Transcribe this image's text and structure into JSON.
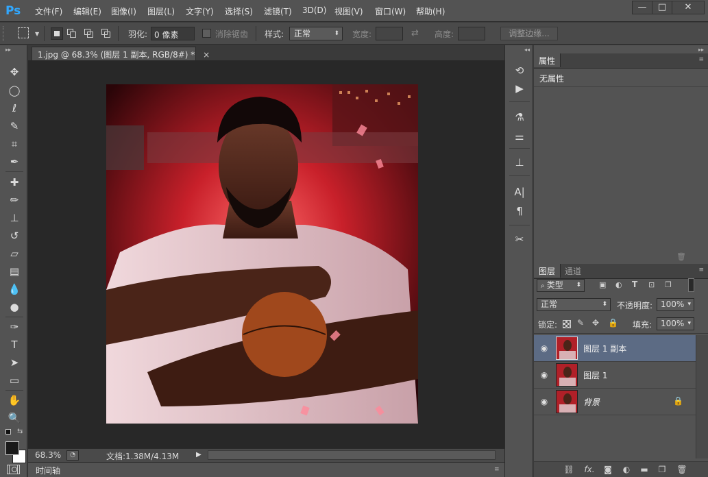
{
  "app": {
    "logo": "Ps"
  },
  "menu": [
    "文件(F)",
    "编辑(E)",
    "图像(I)",
    "图层(L)",
    "文字(Y)",
    "选择(S)",
    "滤镜(T)",
    "3D(D)",
    "视图(V)",
    "窗口(W)",
    "帮助(H)"
  ],
  "window_controls": {
    "minimize": "—",
    "maximize": "□",
    "close": "✕"
  },
  "options": {
    "feather_label": "羽化:",
    "feather_value": "0 像素",
    "antialias_label": "消除锯齿",
    "style_label": "样式:",
    "style_value": "正常",
    "width_label": "宽度:",
    "height_label": "高度:",
    "refine_edge": "调整边缘..."
  },
  "document": {
    "tab_title": "1.jpg @ 68.3% (图层 1 副本, RGB/8#) *",
    "tab_close": "×"
  },
  "status": {
    "zoom": "68.3%",
    "doc_info": "文档:1.38M/4.13M"
  },
  "timeline": {
    "label": "时间轴"
  },
  "properties_panel": {
    "tab": "属性",
    "content": "无属性"
  },
  "layers_panel": {
    "tabs": [
      "图层",
      "通道"
    ],
    "filter_kind": "类型",
    "blend_mode": "正常",
    "opacity_label": "不透明度:",
    "opacity_value": "100%",
    "lock_label": "锁定:",
    "fill_label": "填充:",
    "fill_value": "100%",
    "layers": [
      {
        "name": "图层 1 副本",
        "selected": true,
        "locked": false
      },
      {
        "name": "图层 1",
        "selected": false,
        "locked": false
      },
      {
        "name": "背景",
        "selected": false,
        "locked": true
      }
    ]
  },
  "colors": {
    "accent": "#31a8ff",
    "selected_layer": "#5c6b84",
    "panel_bg": "#535353",
    "canvas_bg": "#282828"
  }
}
